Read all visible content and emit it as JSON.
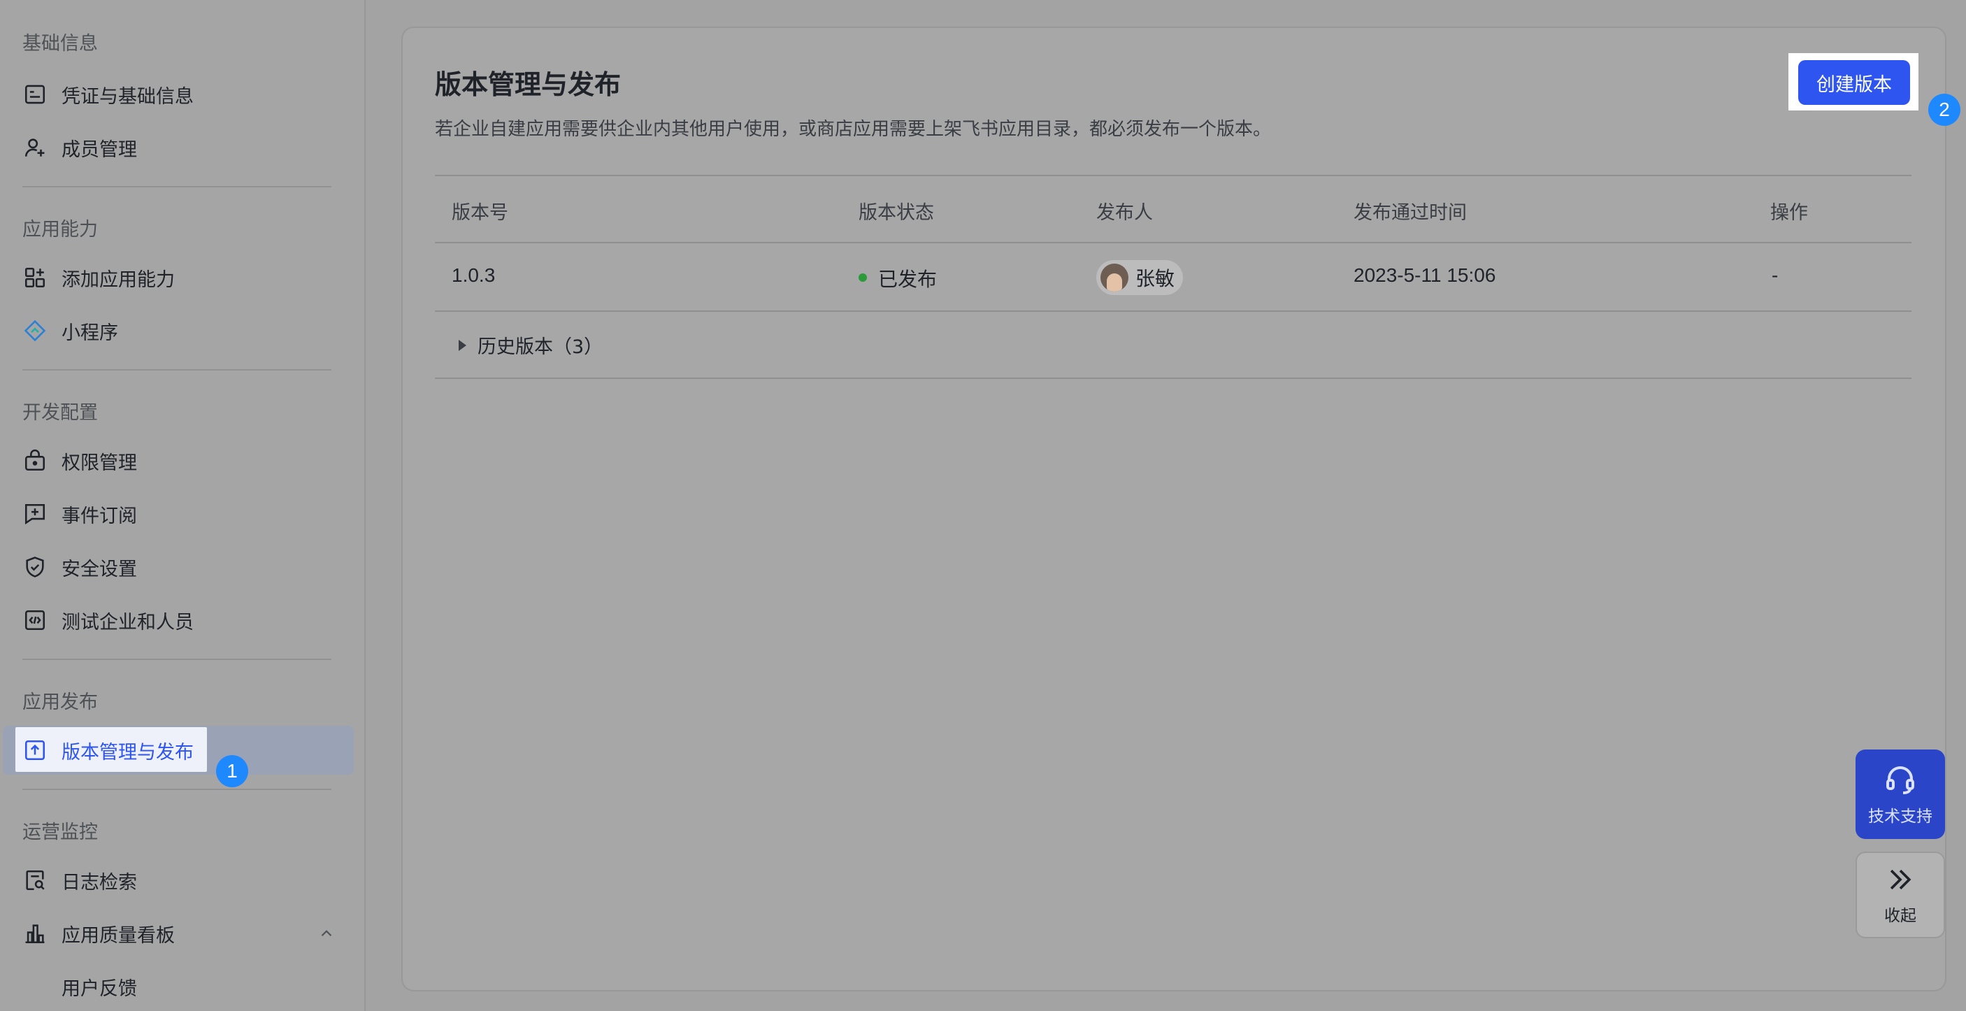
{
  "sidebar": {
    "sections": [
      {
        "title": "基础信息",
        "items": [
          {
            "label": "凭证与基础信息",
            "icon": "credential-icon"
          },
          {
            "label": "成员管理",
            "icon": "add-member-icon"
          }
        ]
      },
      {
        "title": "应用能力",
        "items": [
          {
            "label": "添加应用能力",
            "icon": "app-grid-add-icon"
          },
          {
            "label": "小程序",
            "icon": "mini-program-icon"
          }
        ]
      },
      {
        "title": "开发配置",
        "items": [
          {
            "label": "权限管理",
            "icon": "permission-lock-icon"
          },
          {
            "label": "事件订阅",
            "icon": "event-subscribe-icon"
          },
          {
            "label": "安全设置",
            "icon": "shield-check-icon"
          },
          {
            "label": "测试企业和人员",
            "icon": "code-test-icon"
          }
        ]
      },
      {
        "title": "应用发布",
        "items": [
          {
            "label": "版本管理与发布",
            "icon": "upload-icon",
            "active": true
          }
        ]
      },
      {
        "title": "运营监控",
        "items": [
          {
            "label": "日志检索",
            "icon": "log-search-icon"
          },
          {
            "label": "应用质量看板",
            "icon": "bar-chart-icon"
          },
          {
            "label": "用户反馈"
          }
        ]
      }
    ]
  },
  "badges": {
    "step1": "1",
    "step2": "2"
  },
  "main": {
    "title": "版本管理与发布",
    "description": "若企业自建应用需要供企业内其他用户使用，或商店应用需要上架飞书应用目录，都必须发布一个版本。",
    "create_button": "创建版本",
    "table": {
      "columns": [
        "版本号",
        "版本状态",
        "发布人",
        "发布通过时间",
        "操作"
      ],
      "rows": [
        {
          "version": "1.0.3",
          "status": "已发布",
          "publisher": "张敏",
          "time": "2023-5-11 15:06",
          "action": "-"
        }
      ],
      "history": "历史版本（3）"
    }
  },
  "widgets": {
    "support_label": "技术支持",
    "collapse_label": "收起"
  },
  "colors": {
    "accent": "#2e55f0",
    "badge": "#1e88ff",
    "status_published": "#2a9a3a"
  }
}
